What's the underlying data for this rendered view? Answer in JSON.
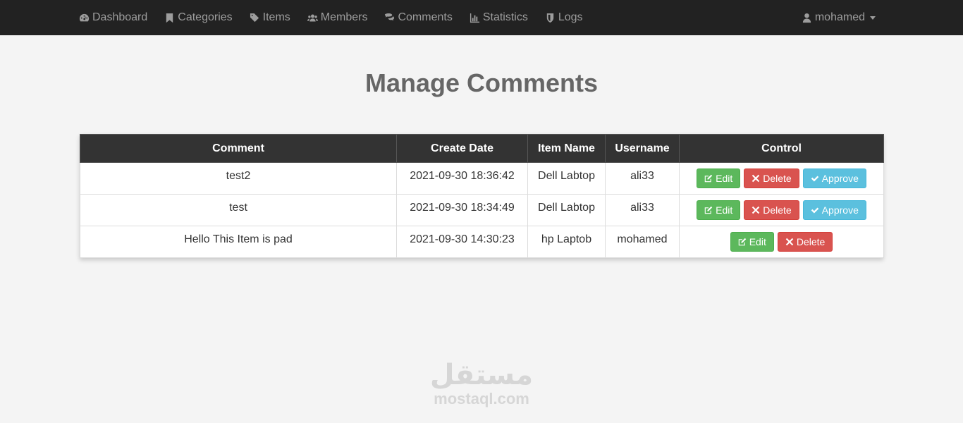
{
  "nav": {
    "items": [
      {
        "label": "Dashboard",
        "icon": "dashboard-icon"
      },
      {
        "label": "Categories",
        "icon": "bookmark-icon"
      },
      {
        "label": "Items",
        "icon": "tags-icon"
      },
      {
        "label": "Members",
        "icon": "users-icon"
      },
      {
        "label": "Comments",
        "icon": "comments-icon"
      },
      {
        "label": "Statistics",
        "icon": "bar-chart-icon"
      },
      {
        "label": "Logs",
        "icon": "shield-icon"
      }
    ],
    "user": "mohamed"
  },
  "page": {
    "title": "Manage Comments"
  },
  "table": {
    "headers": [
      "Comment",
      "Create Date",
      "Item Name",
      "Username",
      "Control"
    ],
    "rows": [
      {
        "comment": "test2",
        "date": "2021-09-30 18:36:42",
        "item": "Dell Labtop",
        "user": "ali33"
      },
      {
        "comment": "test",
        "date": "2021-09-30 18:34:49",
        "item": "Dell Labtop",
        "user": "ali33"
      },
      {
        "comment": "Hello This Item is pad",
        "date": "2021-09-30 14:30:23",
        "item": "hp Laptob",
        "user": "mohamed"
      }
    ],
    "buttons": {
      "edit": "Edit",
      "delete": "Delete",
      "approve": "Approve"
    }
  },
  "watermark": {
    "arabic": "مستقل",
    "latin": "mostaql.com"
  },
  "colors": {
    "navbar": "#222222",
    "nav_text": "#9d9d9d",
    "header_bg": "#333333",
    "edit": "#5cb85c",
    "delete": "#d9534f",
    "approve": "#5bc0de",
    "title": "#666666"
  }
}
